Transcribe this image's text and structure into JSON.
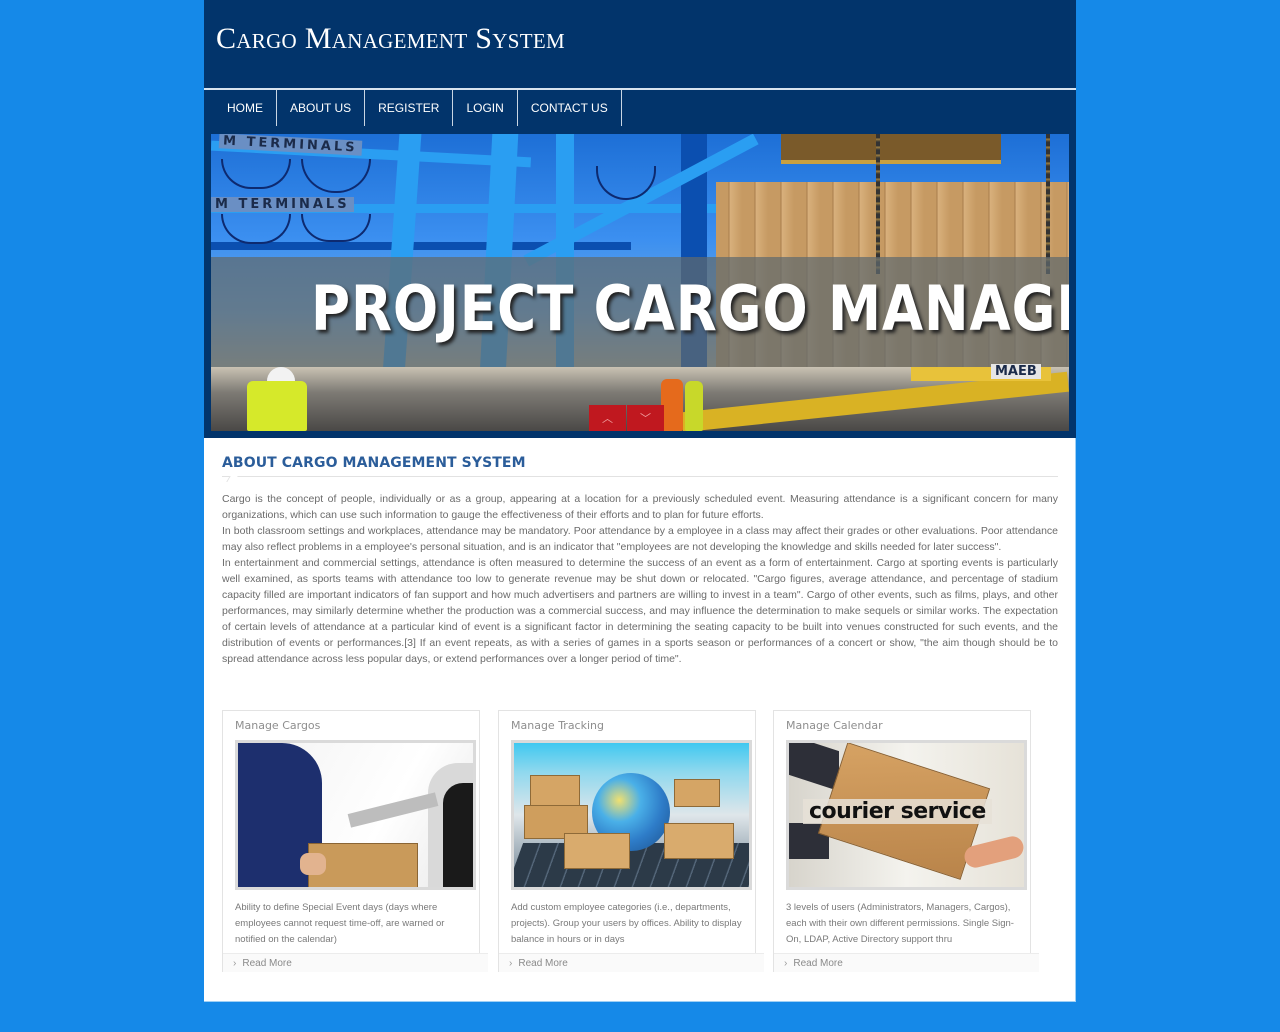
{
  "site": {
    "title": "Cargo Management System"
  },
  "nav": {
    "items": [
      {
        "label": "HOME"
      },
      {
        "label": "ABOUT US"
      },
      {
        "label": "REGISTER"
      },
      {
        "label": "LOGIN"
      },
      {
        "label": "CONTACT US"
      }
    ]
  },
  "banner": {
    "headline": "PROJECT CARGO MANAGE",
    "sign_top": "M TERMINALS",
    "sign_bottom": "M TERMINALS",
    "sign_ship": "MAEB",
    "prev_icon": "chevron-up-icon",
    "next_icon": "chevron-down-icon",
    "prev_glyph": "︿",
    "next_glyph": "﹀"
  },
  "about": {
    "title": "ABOUT CARGO MANAGEMENT SYSTEM",
    "paragraphs": [
      "Cargo is the concept of people, individually or as a group, appearing at a location for a previously scheduled event. Measuring attendance is a significant concern for many organizations, which can use such information to gauge the effectiveness of their efforts and to plan for future efforts.",
      "In both classroom settings and workplaces, attendance may be mandatory. Poor attendance by a employee in a class may affect their grades or other evaluations. Poor attendance may also reflect problems in a employee's personal situation, and is an indicator that \"employees are not developing the knowledge and skills needed for later success\".",
      "In entertainment and commercial settings, attendance is often measured to determine the success of an event as a form of entertainment. Cargo at sporting events is particularly well examined, as sports teams with attendance too low to generate revenue may be shut down or relocated. \"Cargo figures, average attendance, and percentage of stadium capacity filled are important indicators of fan support and how much advertisers and partners are willing to invest in a team\". Cargo of other events, such as films, plays, and other performances, may similarly determine whether the production was a commercial success, and may influence the determination to make sequels or similar works. The expectation of certain levels of attendance at a particular kind of event is a significant factor in determining the seating capacity to be built into venues constructed for such events, and the distribution of events or performances.[3] If an event repeats, as with a series of games in a sports season or performances of a concert or show, \"the aim though should be to spread attendance across less popular days, or extend performances over a longer period of time\"."
    ]
  },
  "cards": [
    {
      "title": "Manage Cargos",
      "image_alt": "person holding clipboard and parcel",
      "description": "Ability to define Special Event days (days where employees cannot request time-off, are warned or notified on the calendar)",
      "link": "Read More"
    },
    {
      "title": "Manage Tracking",
      "image_alt": "globe with cardboard boxes on laptop keyboard",
      "description": "Add custom employee categories (i.e., departments, projects). Group your users by offices. Ability to display balance in hours or in days",
      "link": "Read More"
    },
    {
      "title": "Manage Calendar",
      "image_alt": "courier service hand-off",
      "image_caption": "courier service",
      "description": "3 levels of users (Administrators, Managers, Cargos), each with their own different permissions. Single Sign-On, LDAP, Active Directory support thru",
      "link": "Read More"
    }
  ],
  "colors": {
    "page_background": "#1589e8",
    "header_background": "#02346b",
    "heading_blue": "#2b5d9a",
    "slider_button_red": "#c0181f",
    "body_text": "#6b6b6b"
  }
}
